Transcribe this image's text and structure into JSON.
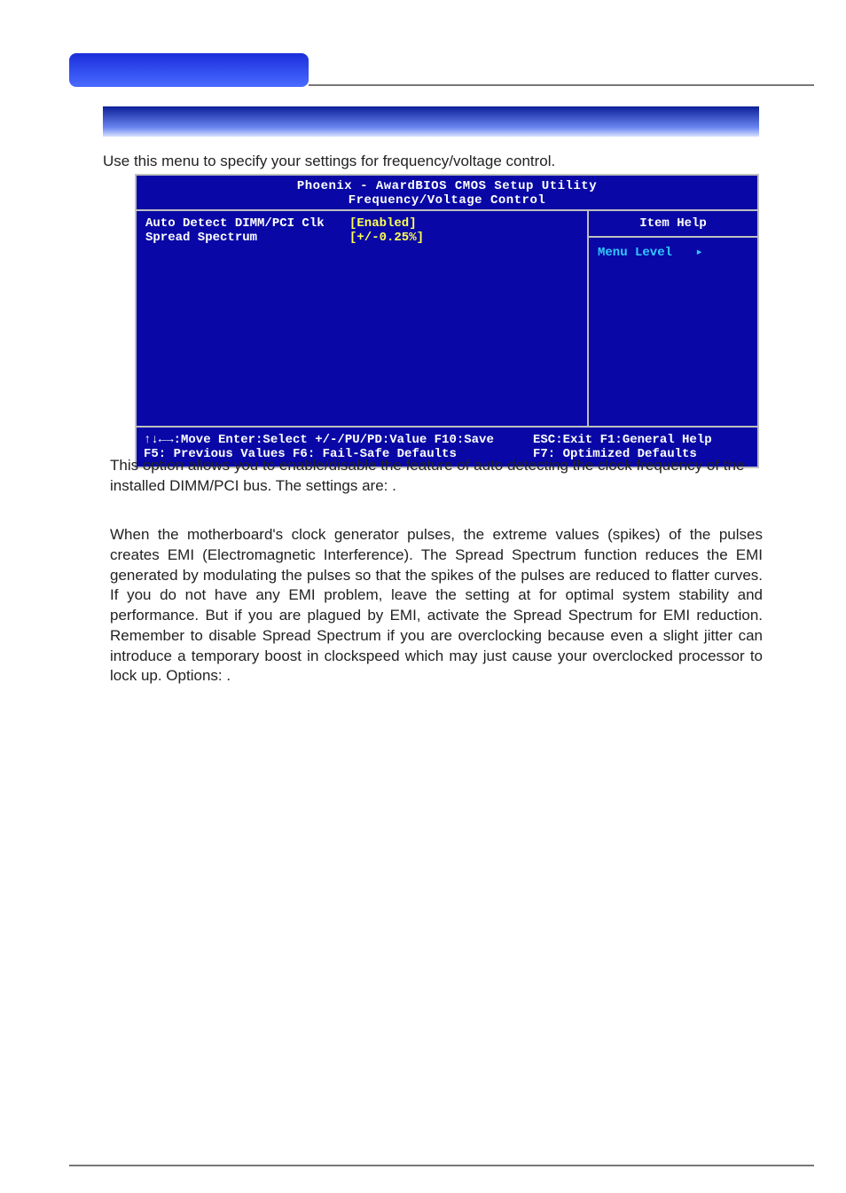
{
  "intro": "Use this menu to specify your settings for frequency/voltage control.",
  "bios": {
    "title_line1": "Phoenix - AwardBIOS CMOS Setup Utility",
    "title_line2": "Frequency/Voltage Control",
    "items": [
      {
        "label": "Auto Detect DIMM/PCI Clk",
        "value": "[Enabled]"
      },
      {
        "label": "Spread Spectrum",
        "value": "[+/-0.25%]"
      }
    ],
    "help_title": "Item Help",
    "menu_level": "Menu Level",
    "footer_left_line1": "↑↓←→:Move  Enter:Select  +/-/PU/PD:Value  F10:Save",
    "footer_left_line2": "F5: Previous Values    F6: Fail-Safe Defaults",
    "footer_right_line1": "ESC:Exit  F1:General Help",
    "footer_right_line2": "F7: Optimized Defaults"
  },
  "para1": "This option allows you to enable/disable the feature of auto detecting the clock frequency of the installed DIMM/PCI bus. The settings are:                              .",
  "para2": "When the motherboard's clock generator pulses, the extreme values (spikes) of the pulses creates EMI (Electromagnetic Interference). The Spread Spectrum function reduces the EMI generated by modulating the pulses so that the spikes of the pulses are reduced to flatter curves. If you do not have any EMI problem, leave the setting at               for optimal system stability and performance. But if you are plagued by EMI, activate the Spread Spectrum for EMI reduction. Remember to disable Spread Spectrum if you are overclocking because even a slight jitter can introduce a temporary boost in clockspeed which may just cause your overclocked processor to lock up. Options:                                                                               ."
}
